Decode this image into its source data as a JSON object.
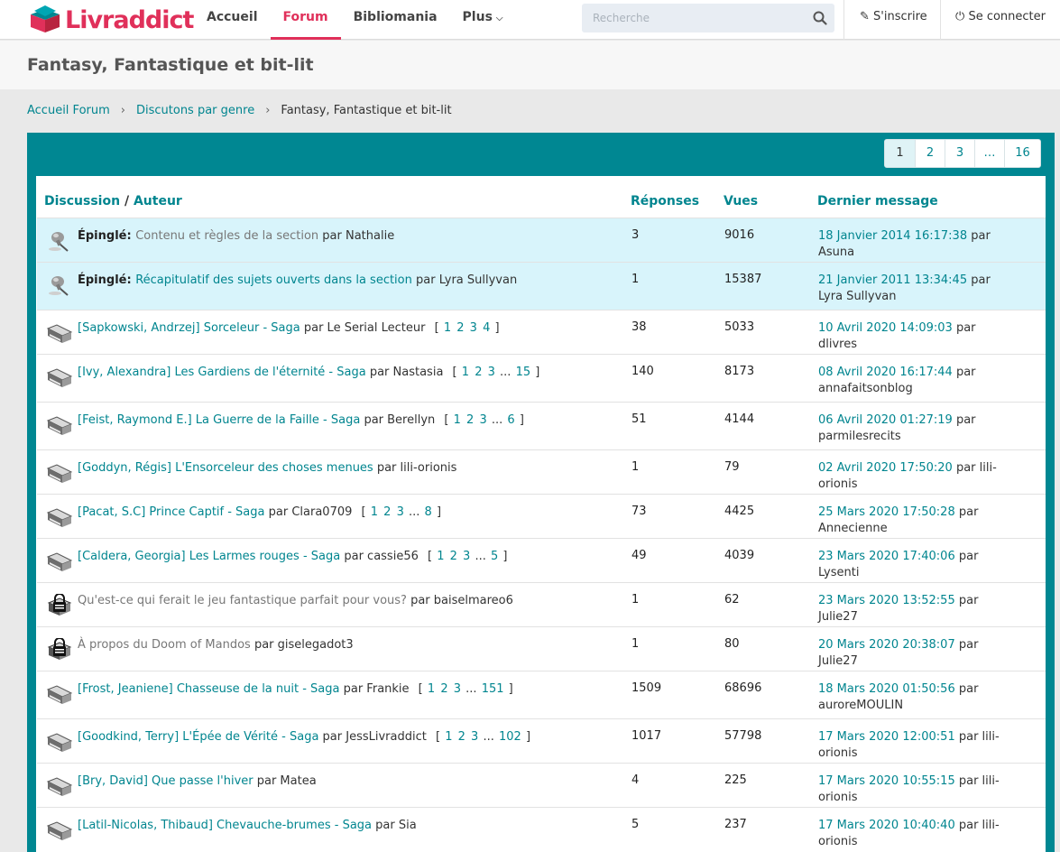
{
  "header": {
    "logo_text_a": "Livr",
    "logo_text_b": "addict",
    "nav": [
      {
        "label": "Accueil",
        "active": false
      },
      {
        "label": "Forum",
        "active": true
      },
      {
        "label": "Bibliomania",
        "active": false
      },
      {
        "label": "Plus",
        "active": false
      }
    ],
    "search_placeholder": "Recherche",
    "signup": "S'inscrire",
    "login": "Se connecter",
    "accent": "#e0305a"
  },
  "page_title": "Fantasy, Fantastique et bit-lit",
  "breadcrumb": [
    "Accueil Forum",
    "Discutons par genre",
    "Fantasy, Fantastique et bit-lit"
  ],
  "pagination": [
    "1",
    "2",
    "3",
    "…",
    "16"
  ],
  "columns": {
    "discussion": "Discussion",
    "slash": "/",
    "author": "Auteur",
    "replies": "Réponses",
    "views": "Vues",
    "last": "Dernier message"
  },
  "by": "par",
  "pinned_label": "Épinglé:",
  "topics": [
    {
      "type": "pinned",
      "title": "Contenu et règles de la section",
      "grey": true,
      "author": "Nathalie",
      "pages": [],
      "replies": "3",
      "views": "9016",
      "last_date": "18 Janvier 2014 16:17:38",
      "last_user": "Asuna"
    },
    {
      "type": "pinned",
      "title": "Récapitulatif des sujets ouverts dans la section",
      "grey": false,
      "author": "Lyra Sullyvan",
      "pages": [],
      "replies": "1",
      "views": "15387",
      "last_date": "21 Janvier 2011 13:34:45",
      "last_user": "Lyra Sullyvan"
    },
    {
      "type": "book",
      "title": "[Sapkowski, Andrzej] Sorceleur - Saga",
      "grey": false,
      "author": "Le Serial Lecteur",
      "pages": [
        "1",
        "2",
        "3",
        "4"
      ],
      "replies": "38",
      "views": "5033",
      "last_date": "10 Avril 2020 14:09:03",
      "last_user": "dlivres"
    },
    {
      "type": "book",
      "title": "[Ivy, Alexandra] Les Gardiens de l'éternité - Saga",
      "grey": false,
      "author": "Nastasia",
      "pages": [
        "1",
        "2",
        "3",
        "...",
        "15"
      ],
      "replies": "140",
      "views": "8173",
      "last_date": "08 Avril 2020 16:17:44",
      "last_user": "annafaitsonblog"
    },
    {
      "type": "book",
      "title": "[Feist, Raymond E.] La Guerre de la Faille - Saga",
      "grey": false,
      "author": "Berellyn",
      "pages": [
        "1",
        "2",
        "3",
        "...",
        "6"
      ],
      "replies": "51",
      "views": "4144",
      "last_date": "06 Avril 2020 01:27:19",
      "last_user": "parmilesrecits"
    },
    {
      "type": "book",
      "title": "[Goddyn, Régis] L'Ensorceleur des choses menues",
      "grey": false,
      "author": "lili-orionis",
      "pages": [],
      "replies": "1",
      "views": "79",
      "last_date": "02 Avril 2020 17:50:20",
      "last_user": "lili-orionis"
    },
    {
      "type": "book",
      "title": "[Pacat, S.C] Prince Captif - Saga",
      "grey": false,
      "author": "Clara0709",
      "pages": [
        "1",
        "2",
        "3",
        "...",
        "8"
      ],
      "replies": "73",
      "views": "4425",
      "last_date": "25 Mars 2020 17:50:28",
      "last_user": "Annecienne"
    },
    {
      "type": "book",
      "title": "[Caldera, Georgia] Les Larmes rouges - Saga",
      "grey": false,
      "author": "cassie56",
      "pages": [
        "1",
        "2",
        "3",
        "...",
        "5"
      ],
      "replies": "49",
      "views": "4039",
      "last_date": "23 Mars 2020 17:40:06",
      "last_user": "Lysenti"
    },
    {
      "type": "locked",
      "title": "Qu'est-ce qui ferait le jeu fantastique parfait pour vous?",
      "grey": true,
      "author": "baiselmareo6",
      "pages": [],
      "replies": "1",
      "views": "62",
      "last_date": "23 Mars 2020 13:52:55",
      "last_user": "Julie27"
    },
    {
      "type": "locked",
      "title": "À propos du Doom of Mandos",
      "grey": true,
      "author": "giselegadot3",
      "pages": [],
      "replies": "1",
      "views": "80",
      "last_date": "20 Mars 2020 20:38:07",
      "last_user": "Julie27"
    },
    {
      "type": "book",
      "title": "[Frost, Jeaniene] Chasseuse de la nuit - Saga",
      "grey": false,
      "author": "Frankie",
      "pages": [
        "1",
        "2",
        "3",
        "...",
        "151"
      ],
      "replies": "1509",
      "views": "68696",
      "last_date": "18 Mars 2020 01:50:56",
      "last_user": "auroreMOULIN"
    },
    {
      "type": "book",
      "title": "[Goodkind, Terry] L'Épée de Vérité - Saga",
      "grey": false,
      "author": "JessLivraddict",
      "pages": [
        "1",
        "2",
        "3",
        "...",
        "102"
      ],
      "replies": "1017",
      "views": "57798",
      "last_date": "17 Mars 2020 12:00:51",
      "last_user": "lili-orionis"
    },
    {
      "type": "book",
      "title": "[Bry, David] Que passe l'hiver",
      "grey": false,
      "author": "Matea",
      "pages": [],
      "replies": "4",
      "views": "225",
      "last_date": "17 Mars 2020 10:55:15",
      "last_user": "lili-orionis"
    },
    {
      "type": "book",
      "title": "[Latil-Nicolas, Thibaud] Chevauche-brumes - Saga",
      "grey": false,
      "author": "Sia",
      "pages": [],
      "replies": "5",
      "views": "237",
      "last_date": "17 Mars 2020 10:40:40",
      "last_user": "lili-orionis"
    }
  ]
}
